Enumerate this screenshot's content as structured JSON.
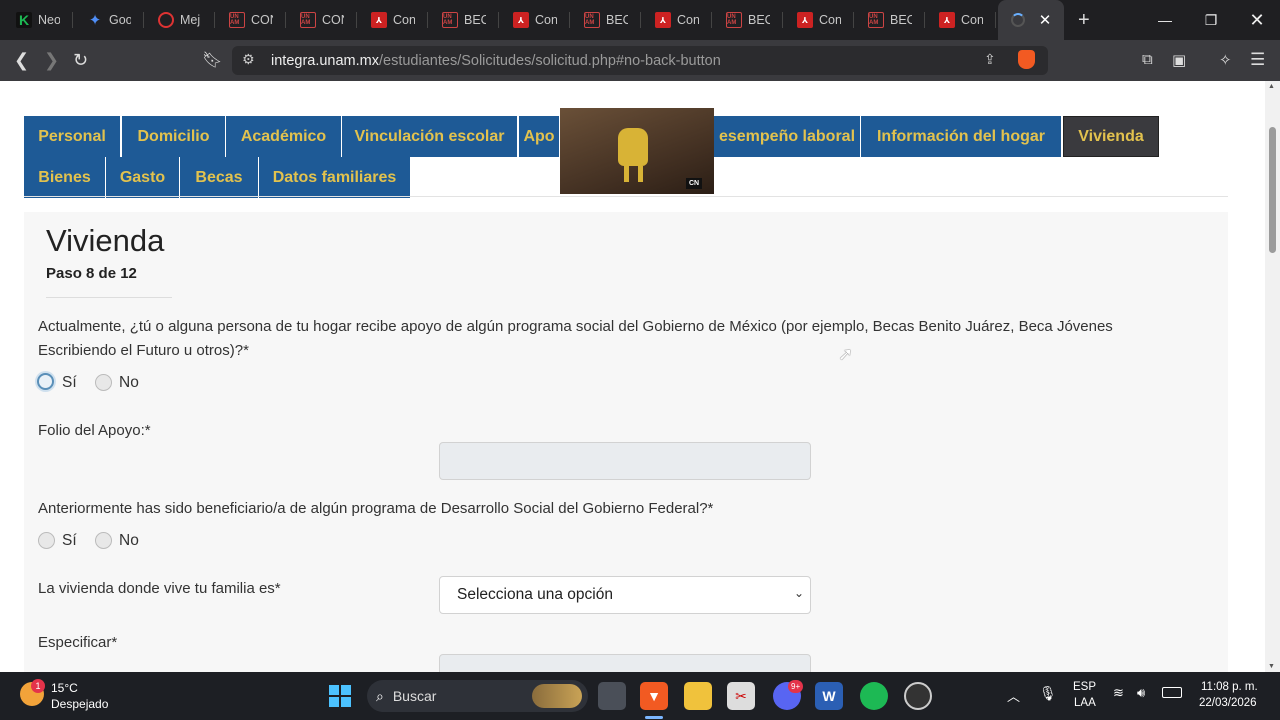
{
  "browser": {
    "tabs": [
      {
        "title": "Neo",
        "icon": "k-icon"
      },
      {
        "title": "Goo",
        "icon": "gemini-icon"
      },
      {
        "title": "Mej",
        "icon": "record-icon"
      },
      {
        "title": "CON",
        "icon": "unam-icon"
      },
      {
        "title": "CON",
        "icon": "unam-icon"
      },
      {
        "title": "Con",
        "icon": "pdf-icon"
      },
      {
        "title": "BEC",
        "icon": "unam-icon"
      },
      {
        "title": "Con",
        "icon": "pdf-icon"
      },
      {
        "title": "BEC",
        "icon": "unam-icon"
      },
      {
        "title": "Con",
        "icon": "pdf-icon"
      },
      {
        "title": "BEC",
        "icon": "unam-icon"
      },
      {
        "title": "Con",
        "icon": "pdf-icon"
      },
      {
        "title": "BEC",
        "icon": "unam-icon"
      },
      {
        "title": "Con",
        "icon": "pdf-icon"
      }
    ],
    "url_domain": "integra.unam.mx",
    "url_path": "/estudiantes/Solicitudes/solicitud.php#no-back-button"
  },
  "nav": {
    "tabs_row1": [
      "Personal",
      "Domicilio",
      "Académico",
      "Vinculación escolar",
      "Apo",
      "esempeño laboral",
      "Información del hogar",
      "Vivienda"
    ],
    "tabs_row2": [
      "Bienes",
      "Gasto",
      "Becas",
      "Datos familiares"
    ],
    "active": "Vivienda",
    "video_badge": "CN"
  },
  "form": {
    "title": "Vivienda",
    "step": "Paso 8 de 12",
    "q1_line1": "Actualmente, ¿tú o alguna persona de tu hogar recibe apoyo de algún programa social del Gobierno de México (por ejemplo, Becas Benito Juárez, Beca Jóvenes",
    "q1_line2": "Escribiendo el Futuro u otros)?*",
    "yes": "Sí",
    "no": "No",
    "folio_label": "Folio del Apoyo:*",
    "q2": "Anteriormente has sido beneficiario/a de algún programa de Desarrollo Social del Gobierno Federal?*",
    "vivienda_label": "La vivienda donde vive tu familia es*",
    "vivienda_select": "Selecciona una opción",
    "especificar_label": "Especificar*"
  },
  "taskbar": {
    "weather_temp": "15°C",
    "weather_desc": "Despejado",
    "weather_badge": "1",
    "search_label": "Buscar",
    "lang1": "ESP",
    "lang2": "LAA",
    "time": "11:08 p. m.",
    "date": "22/03/2026",
    "discord_badge": "9+"
  }
}
